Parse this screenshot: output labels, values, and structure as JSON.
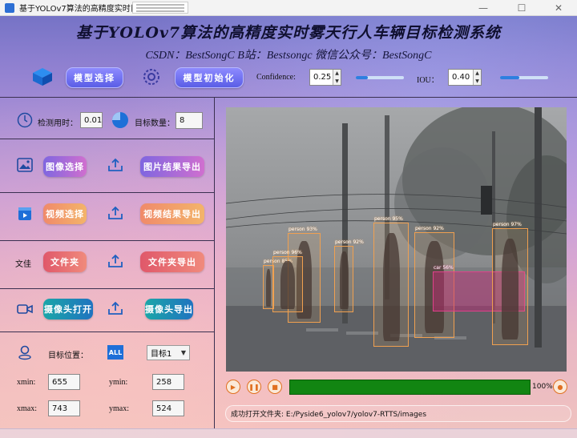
{
  "window": {
    "title": "基于YOLOv7算法的高精度实时目标检测系统",
    "controls": [
      "—",
      "☐",
      "✕"
    ]
  },
  "header": {
    "title": "基于YOLOv7算法的高精度实时雾天行人车辆目标检测系统",
    "subtitle": "CSDN：BestSongC   B站：Bestsongc   微信公众号：BestSongC"
  },
  "toolbar": {
    "model_select": "模型选择",
    "model_init": "模型初始化",
    "confidence_label": "Confidence:",
    "confidence_value": "0.25",
    "confidence_level": 0.25,
    "iou_label": "IOU：",
    "iou_value": "0.40",
    "iou_level": 0.4
  },
  "stats": {
    "time_label": "检测用时：",
    "time_value": "0.01",
    "count_label": "目标数量：",
    "count_value": "8"
  },
  "actions": {
    "image_select": "图像选择",
    "image_export": "图片结果导出",
    "video_select": "视频选择",
    "video_export": "视频结果导出",
    "folder_icon_text": "文佳",
    "folder_select": "文件夹",
    "folder_export": "文件夹导出",
    "camera_open": "摄像头打开",
    "camera_export": "摄像头导出"
  },
  "target": {
    "pos_label": "目标位置：",
    "all_icon_text": "ALL",
    "selected": "目标1",
    "xmin_label": "xmin:",
    "xmin": "655",
    "ymin_label": "ymin:",
    "ymin": "258",
    "xmax_label": "xmax:",
    "xmax": "743",
    "ymax_label": "ymax:",
    "ymax": "524"
  },
  "detections": [
    {
      "label": "person 85%",
      "color": "#f0a050"
    },
    {
      "label": "person 93%",
      "color": "#f0a050"
    },
    {
      "label": "person 96%",
      "color": "#f0a050"
    },
    {
      "label": "person 92%",
      "color": "#f0a050"
    },
    {
      "label": "person 95%",
      "color": "#f0a050"
    },
    {
      "label": "person 92%",
      "color": "#f0a050"
    },
    {
      "label": "car 56%",
      "color": "#e0408a"
    },
    {
      "label": "person 97%",
      "color": "#f0a050"
    }
  ],
  "player": {
    "progress_percent": 100,
    "progress_text": "100%"
  },
  "status": {
    "text": "成功打开文件夹: E:/Pyside6_yolov7/yolov7-RTTS/images"
  }
}
